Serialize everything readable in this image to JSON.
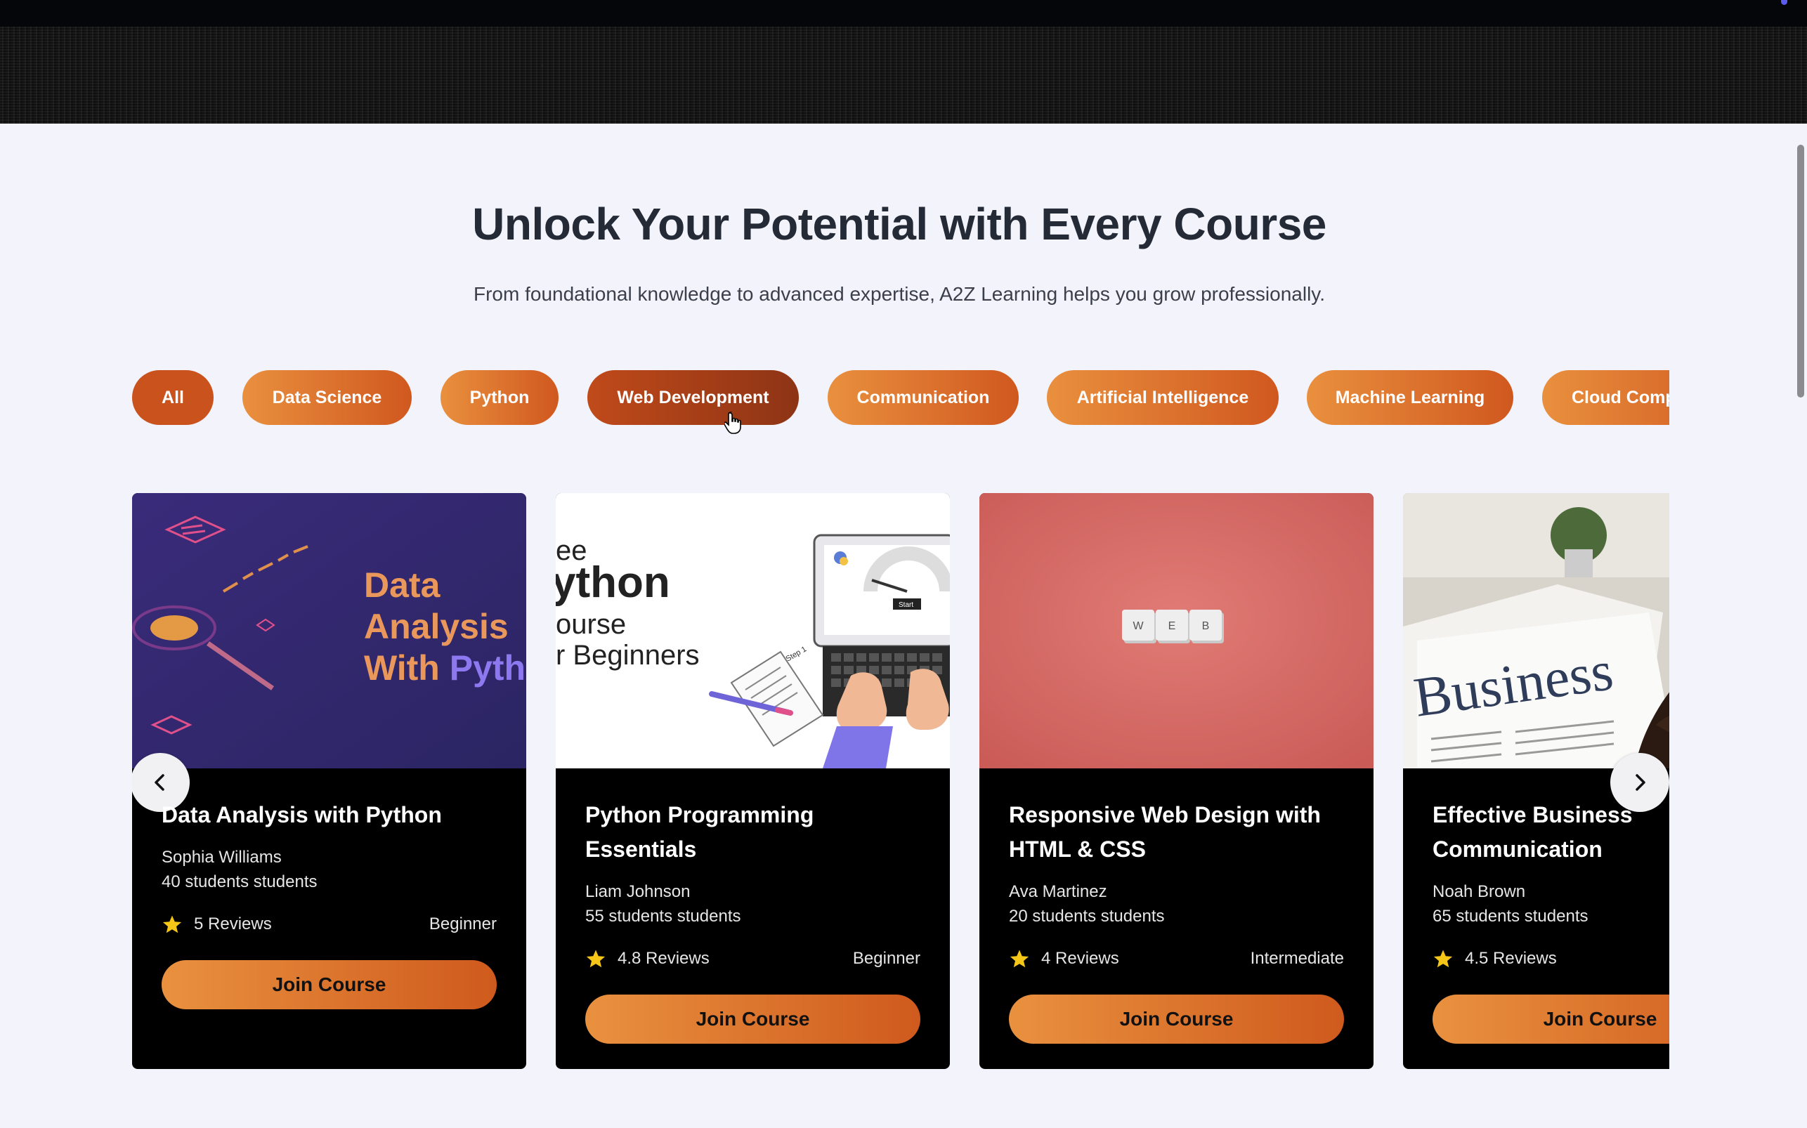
{
  "section": {
    "headline": "Unlock Your Potential with Every Course",
    "subline": "From foundational knowledge to advanced expertise, A2Z Learning helps you grow professionally."
  },
  "filters": [
    {
      "label": "All"
    },
    {
      "label": "Data Science"
    },
    {
      "label": "Python"
    },
    {
      "label": "Web Development"
    },
    {
      "label": "Communication"
    },
    {
      "label": "Artificial Intelligence"
    },
    {
      "label": "Machine Learning"
    },
    {
      "label": "Cloud Computing"
    }
  ],
  "courses": [
    {
      "title": "Data Analysis with Python",
      "instructor": "Sophia Williams",
      "students": "40 students students",
      "reviews": "5 Reviews",
      "level": "Beginner",
      "button": "Join Course",
      "image_text": [
        "Data",
        "Analysis",
        "With ",
        "Python"
      ]
    },
    {
      "title": "Python Programming Essentials",
      "instructor": "Liam Johnson",
      "students": "55 students students",
      "reviews": "4.8 Reviews",
      "level": "Beginner",
      "button": "Join Course",
      "image_text": [
        "ee",
        "ython",
        "ourse",
        "r Beginners",
        "Start",
        "Step 1"
      ]
    },
    {
      "title": "Responsive Web Design with HTML & CSS",
      "instructor": "Ava Martinez",
      "students": "20 students students",
      "reviews": "4 Reviews",
      "level": "Intermediate",
      "button": "Join Course",
      "image_text": [
        "W",
        "E",
        "B"
      ]
    },
    {
      "title": "Effective Business Communication",
      "instructor": "Noah Brown",
      "students": "65 students students",
      "reviews": "4.5 Reviews",
      "level": "",
      "button": "Join Course",
      "image_text": [
        "Business"
      ]
    }
  ],
  "colors": {
    "accent_start": "#e9903e",
    "accent_end": "#d0581f",
    "page_bg": "#f3f3fb",
    "card_bg": "#000000",
    "star": "#f5c518"
  },
  "icons": {
    "prev": "chevron-left-icon",
    "next": "chevron-right-icon",
    "rating": "star-icon",
    "cursor": "hand-cursor-icon"
  }
}
